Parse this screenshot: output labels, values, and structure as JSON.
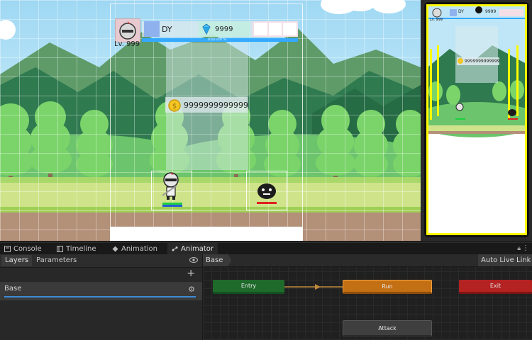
{
  "scene": {
    "level_label": "Lv. 999",
    "player_name": "DY",
    "gem_count": "9999",
    "exp_bar_text": "100/100 %",
    "coin_count": "9999999999999"
  },
  "game_view": {
    "level_label": "Lv. 999",
    "player_name": "DY",
    "gem_count": "9999",
    "coin_count": "9999999999999"
  },
  "tabs": [
    {
      "label": "Console",
      "icon": "console-icon"
    },
    {
      "label": "Timeline",
      "icon": "timeline-icon"
    },
    {
      "label": "Animation",
      "icon": "animation-icon"
    },
    {
      "label": "Animator",
      "icon": "animator-icon"
    }
  ],
  "left_panel": {
    "tab_layers": "Layers",
    "tab_parameters": "Parameters",
    "add_label": "+",
    "layer_name": "Base"
  },
  "graph": {
    "breadcrumb": "Base",
    "auto_live_link": "Auto Live Link",
    "states": {
      "entry": "Entry",
      "run": "Run",
      "exit": "Exit",
      "attack": "Attack"
    }
  },
  "colors": {
    "entry": "#1f6b2b",
    "run": "#c36f13",
    "exit": "#b52222",
    "attack": "#3f3f3f",
    "phone_border": "#fffb00",
    "exp_bar": "#33a9ff"
  }
}
